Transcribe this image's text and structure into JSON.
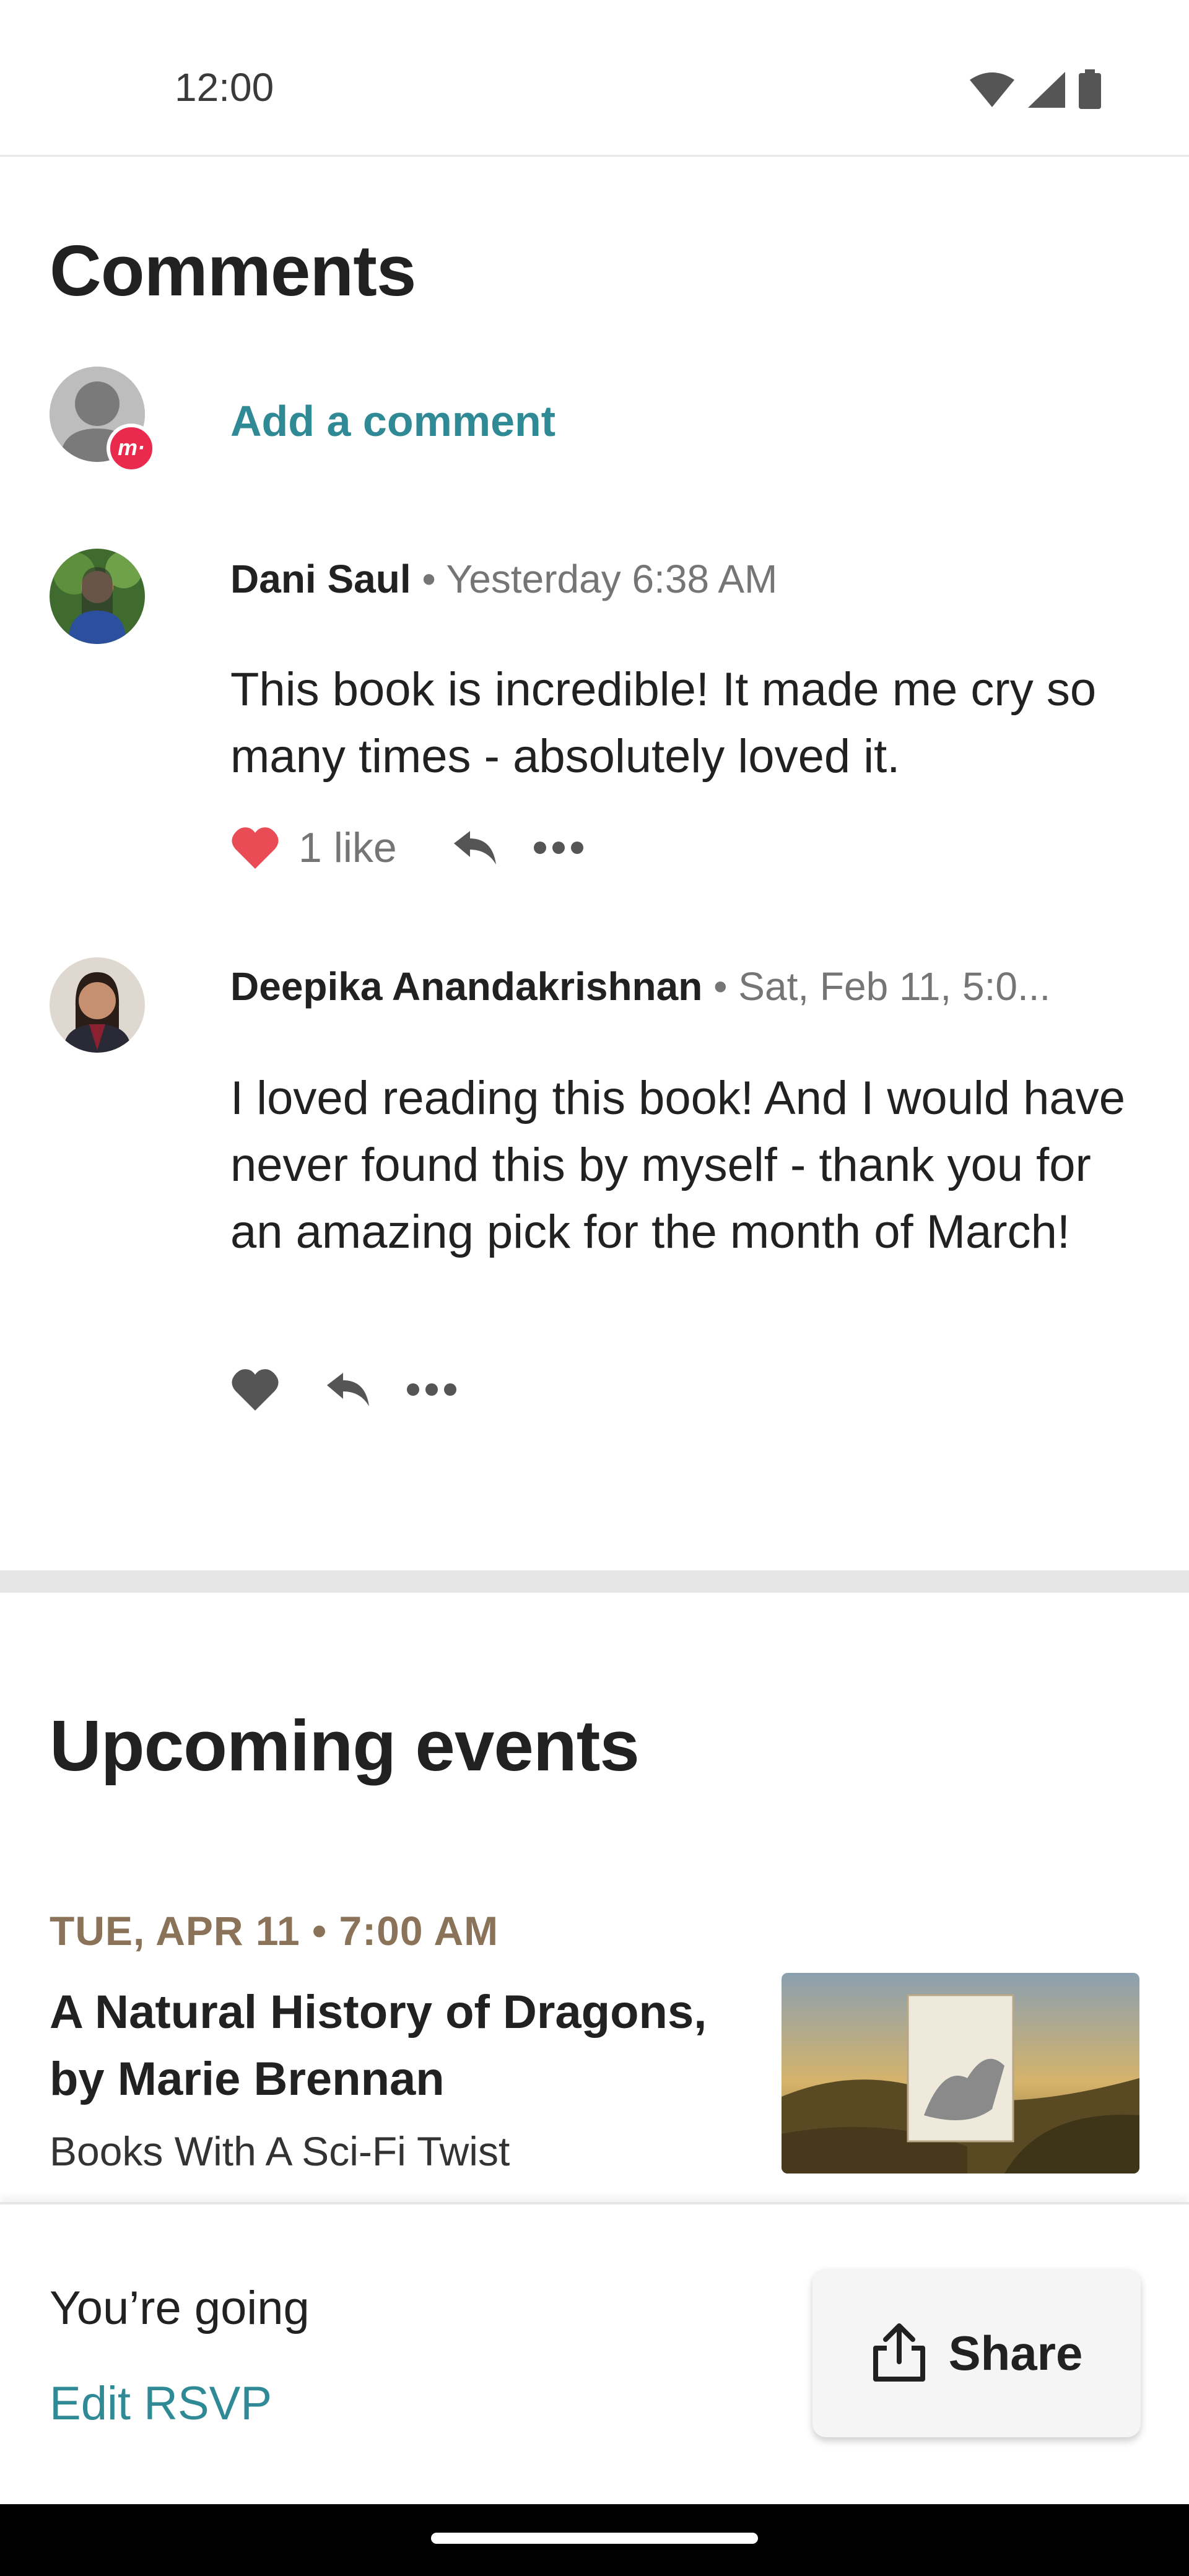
{
  "status_bar": {
    "time": "12:00",
    "icons": [
      "wifi-icon",
      "signal-icon",
      "battery-icon"
    ]
  },
  "comments": {
    "title": "Comments",
    "add_comment_label": "Add a comment",
    "items": [
      {
        "author": "Dani Saul",
        "separator": " • ",
        "timestamp": "Yesterday 6:38 AM",
        "body": "This book is incredible! It made me cry so many times - absolutely loved it.",
        "likes_label": "1 like",
        "liked": true
      },
      {
        "author": "Deepika Anandakrishnan",
        "separator": " • ",
        "timestamp": "Sat, Feb 11, 5:0...",
        "body": "I loved reading this book! And I would have never found this by myself - thank you for an amazing pick for the month of March!",
        "likes_label": "",
        "liked": false
      }
    ]
  },
  "events": {
    "title": "Upcoming events",
    "items": [
      {
        "date": "TUE, APR 11 • 7:00 AM",
        "title": "A Natural History of Dragons, by Marie Brennan",
        "group": "Books With A Sci-Fi Twist"
      }
    ]
  },
  "rsvp_bar": {
    "status": "You’re going",
    "edit_label": "Edit RSVP",
    "share_label": "Share"
  },
  "colors": {
    "accent_teal": "#2f8a96",
    "like_red": "#ea4c56",
    "event_date_brown": "#8a7358",
    "badge_red": "#ea2a4c"
  }
}
